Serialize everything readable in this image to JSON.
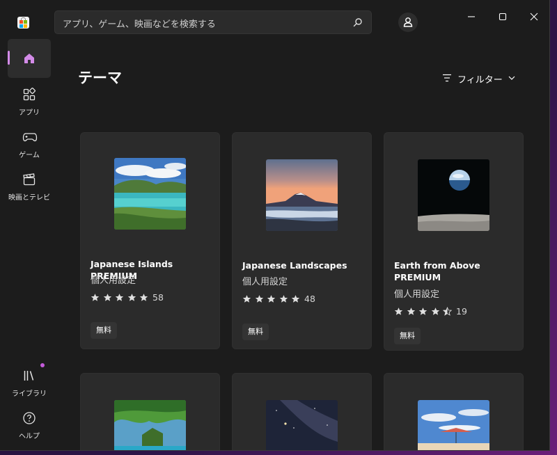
{
  "search": {
    "placeholder": "アプリ、ゲーム、映画などを検索する"
  },
  "sidebar": {
    "items": [
      {
        "label": "",
        "icon": "home-icon"
      },
      {
        "label": "アプリ",
        "icon": "apps-icon"
      },
      {
        "label": "ゲーム",
        "icon": "gamepad-icon"
      },
      {
        "label": "映画とテレビ",
        "icon": "clapperboard-icon"
      },
      {
        "label": "ライブラリ",
        "icon": "library-icon"
      },
      {
        "label": "ヘルプ",
        "icon": "help-icon"
      }
    ]
  },
  "main": {
    "title": "テーマ",
    "filter_label": "フィルター"
  },
  "cards": [
    {
      "title": "Japanese Islands PREMIUM",
      "category": "個人用設定",
      "rating": 5,
      "rating_count": "58",
      "price": "無料"
    },
    {
      "title": "Japanese Landscapes",
      "category": "個人用設定",
      "rating": 5,
      "rating_count": "48",
      "price": "無料"
    },
    {
      "title": "Earth from Above PREMIUM",
      "category": "個人用設定",
      "rating": 4.5,
      "rating_count": "19",
      "price": "無料"
    }
  ],
  "colors": {
    "accent": "#d38be8",
    "badge_dot": "#c35bd9",
    "background": "#1c1c1c",
    "card": "#2b2b2b"
  }
}
